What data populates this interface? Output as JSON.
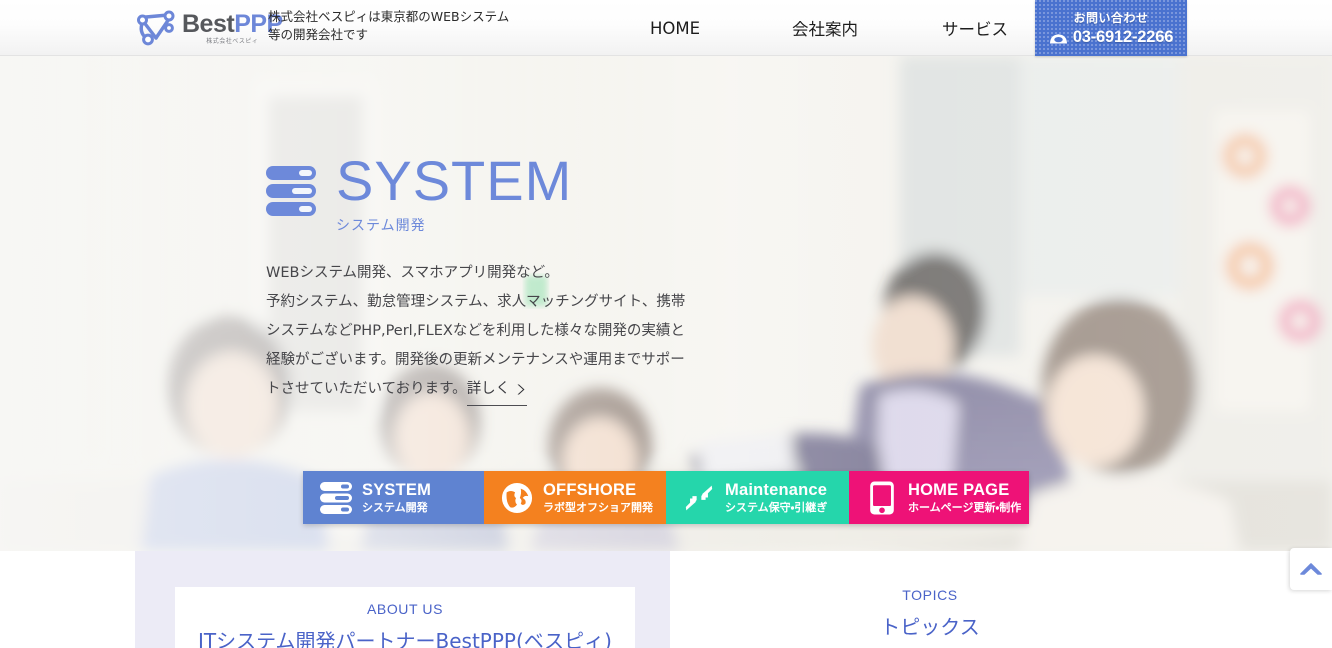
{
  "header": {
    "logo": {
      "word_dark": "Best",
      "word_blue": "PPP",
      "sub": "株式会社ベスピィ",
      "icon": "network-nodes-icon"
    },
    "tagline_line1": "株式会社ベスピィは東京都のWEBシステム",
    "tagline_line2": "等の開発会社です",
    "nav": [
      {
        "label": "HOME",
        "name": "nav-home"
      },
      {
        "label": "会社案内",
        "name": "nav-company"
      },
      {
        "label": "サービス",
        "name": "nav-service"
      }
    ],
    "contact": {
      "title": "お問い合わせ",
      "tel": "03-6912-2266",
      "icon": "telephone-icon",
      "bg_color": "#4a72cf"
    }
  },
  "hero": {
    "icon": "server-stack-icon",
    "title": "SYSTEM",
    "subtitle": "システム開発",
    "title_color": "#6d89da",
    "body_line1": "WEBシステム開発、スマホアプリ開発など。",
    "body_line2": "予約システム、勤怠管理システム、求人マッチングサイト、携帯",
    "body_line3": "システムなどPHP,Perl,FLEXなどを利用した様々な開発の実績と",
    "body_line4": "経験がございます。開発後の更新メンテナンスや運用までサポー",
    "body_line5": "トさせていただいております。",
    "more_label": "詳しく",
    "more_icon": "chevron-right-icon"
  },
  "services": [
    {
      "en": "SYSTEM",
      "ja": "システム開発",
      "color": "#5f83d1",
      "icon": "server-stack-icon",
      "name": "service-system"
    },
    {
      "en": "OFFSHORE",
      "ja": "ラボ型オフショア開発",
      "color": "#f4811f",
      "icon": "globe-icon",
      "name": "service-offshore"
    },
    {
      "en": "Maintenance",
      "ja": "システム保守・引継ぎ",
      "color": "#25d6ab",
      "icon": "compress-arrows-icon",
      "name": "service-maintenance"
    },
    {
      "en": "HOME PAGE",
      "ja": "ホームページ更新・制作",
      "color": "#ee1277",
      "icon": "smartphone-icon",
      "name": "service-homepage"
    }
  ],
  "below": {
    "about": {
      "en": "ABOUT US",
      "heading": "ITシステム開発パートナーBestPPP(ベスピィ)"
    },
    "topics": {
      "en": "TOPICS",
      "ja": "トピックス"
    }
  },
  "scroll_top": {
    "icon": "chevron-up-icon",
    "color": "#6d89da"
  }
}
